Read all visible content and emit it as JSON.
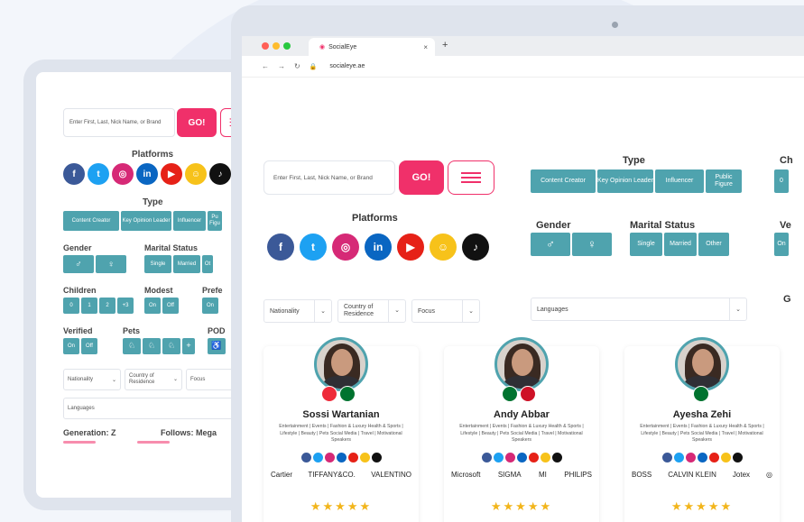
{
  "colors": {
    "accent": "#f0306a",
    "teal": "#4fa3ae",
    "star": "#f2b51b"
  },
  "platform_icons": [
    {
      "name": "facebook-icon",
      "glyph": "f",
      "color": "#3b5998"
    },
    {
      "name": "twitter-icon",
      "glyph": "t",
      "color": "#1da1f2"
    },
    {
      "name": "instagram-icon",
      "glyph": "◎",
      "color": "#d62976"
    },
    {
      "name": "linkedin-icon",
      "glyph": "in",
      "color": "#0a66c2"
    },
    {
      "name": "youtube-icon",
      "glyph": "▶",
      "color": "#e62117"
    },
    {
      "name": "snapchat-icon",
      "glyph": "☺",
      "color": "#f7c21a"
    },
    {
      "name": "tiktok-icon",
      "glyph": "♪",
      "color": "#111111"
    }
  ],
  "tablet": {
    "search_placeholder": "Enter First, Last, Nick Name, or Brand",
    "go_label": "GO!",
    "platforms_title": "Platforms",
    "type_title": "Type",
    "type_options": [
      "Content Creator",
      "Key Opinion Leader",
      "Influencer",
      "Pu Figu"
    ],
    "gender_label": "Gender",
    "marital_label": "Marital Status",
    "gender_options": [
      "♂",
      "♀"
    ],
    "marital_options": [
      "Single",
      "Married",
      "Ot"
    ],
    "children_label": "Children",
    "children_options": [
      "0",
      "1",
      "2",
      "+3"
    ],
    "modest_label": "Modest",
    "modest_options": [
      "On",
      "Off"
    ],
    "pref_label": "Prefe",
    "pref_options": [
      "On"
    ],
    "verified_label": "Verified",
    "verified_options": [
      "On",
      "Off"
    ],
    "pets_label": "Pets",
    "pod_label": "POD",
    "nationality": "Nationality",
    "country": "Country of Residence",
    "focus": "Focus",
    "languages": "Languages",
    "generation": "Generation: Z",
    "follows": "Follows: Mega"
  },
  "browser": {
    "tab_title": "SocialEye",
    "url": "socialeye.ae",
    "search_placeholder": "Enter First, Last, Nick Name, or Brand",
    "go_label": "GO!",
    "platforms_title": "Platforms",
    "type_title": "Type",
    "type_options": [
      "Content Creator",
      "Key Opinion Leader",
      "Influencer",
      "Public Figure"
    ],
    "cut_col_title": "Ch",
    "cut_col_value": "0",
    "gender_label": "Gender",
    "marital_label": "Marital Status",
    "gender_options": [
      "♂",
      "♀"
    ],
    "marital_options": [
      "Single",
      "Married",
      "Other"
    ],
    "cut_ve_title": "Ve",
    "cut_ve_value": "On",
    "nationality": "Nationality",
    "country": "Country of Residence",
    "focus": "Focus",
    "languages": "Languages",
    "cut_g": "G"
  },
  "influencers": [
    {
      "name": "Sossi Wartanian",
      "categories": "Entertainment | Events | Fashion & Luxury Health & Sports | Lifestyle | Beauty | Pets Social Media | Travel | Motivational Speakers",
      "brands": [
        "Cartier",
        "TIFFANY&CO.",
        "VALENTINO"
      ],
      "stars": "★★★★★",
      "flags": [
        "#ee2b3a",
        "#00732f"
      ]
    },
    {
      "name": "Andy Abbar",
      "categories": "Entertainment | Events | Fashion & Luxury Health & Sports | Lifestyle | Beauty | Pets Social Media | Travel | Motivational Speakers",
      "brands": [
        "Microsoft",
        "SIGMA",
        "MI",
        "PHILIPS"
      ],
      "stars": "★★★★★",
      "flags": [
        "#00732f",
        "#ce1126"
      ]
    },
    {
      "name": "Ayesha Zehi",
      "categories": "Entertainment | Events | Fashion & Luxury Health & Sports | Lifestyle | Beauty | Pets Social Media | Travel | Motivational Speakers",
      "brands": [
        "BOSS",
        "CALVIN KLEIN",
        "Jotex",
        "◎"
      ],
      "stars": "★★★★★",
      "flags": [
        "#00732f"
      ]
    }
  ]
}
